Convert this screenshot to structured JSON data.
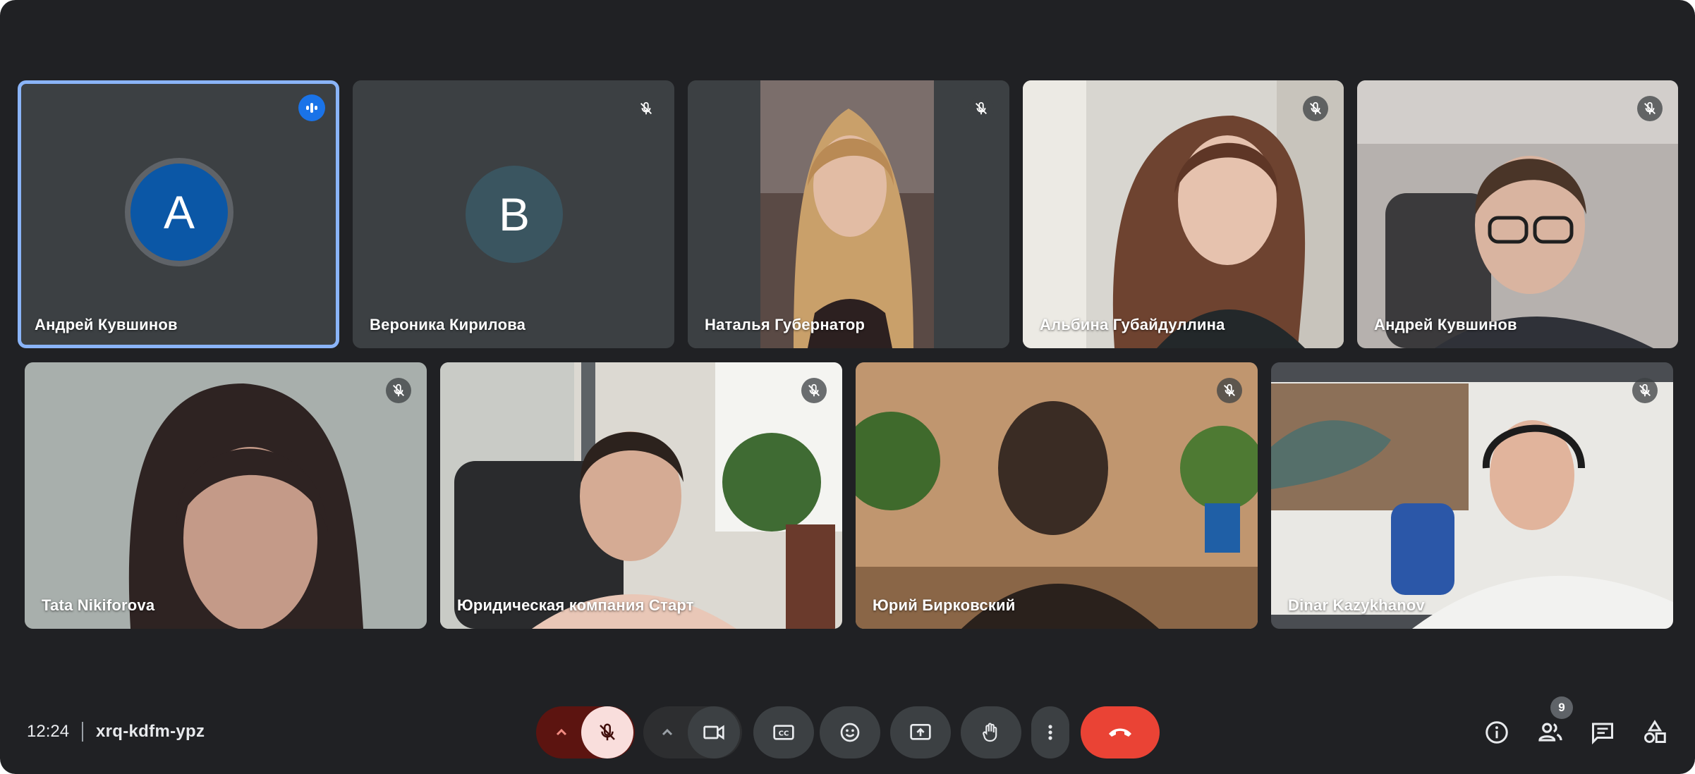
{
  "meeting": {
    "time": "12:24",
    "code": "xrq-kdfm-ypz",
    "participant_count": "9"
  },
  "participants": [
    {
      "name": "Андрей Кувшинов",
      "avatar_letter": "A",
      "avatar_color": "#0b57a6",
      "status": "speaking"
    },
    {
      "name": "Вероника Кирилова",
      "avatar_letter": "B",
      "avatar_color": "#3a5560",
      "status": "muted"
    },
    {
      "name": "Наталья Губернатор",
      "status": "muted"
    },
    {
      "name": "Альбина Губайдуллина",
      "status": "muted"
    },
    {
      "name": "Андрей Кувшинов",
      "status": "muted"
    },
    {
      "name": "Tata Nikiforova",
      "status": "muted"
    },
    {
      "name": "Юридическая компания Старт",
      "status": "muted"
    },
    {
      "name": "Юрий Бирковский",
      "status": "muted"
    },
    {
      "name": "Dinar Kazykhanov",
      "status": "muted"
    }
  ],
  "controls": {
    "icons": [
      "chevron-up-icon",
      "mic-off-icon",
      "chevron-up-icon",
      "camera-icon",
      "captions-icon",
      "emoji-icon",
      "present-icon",
      "raise-hand-icon",
      "more-vert-icon",
      "end-call-icon"
    ],
    "end_call_color": "#ea4335",
    "mic_off_color": "#f9dedc"
  },
  "side_icons": [
    "info-icon",
    "people-icon",
    "chat-icon",
    "activities-icon"
  ],
  "colors": {
    "background": "#202124",
    "tile": "#3c4043",
    "active_border": "#8ab4f8",
    "speaking": "#1a73e8"
  }
}
